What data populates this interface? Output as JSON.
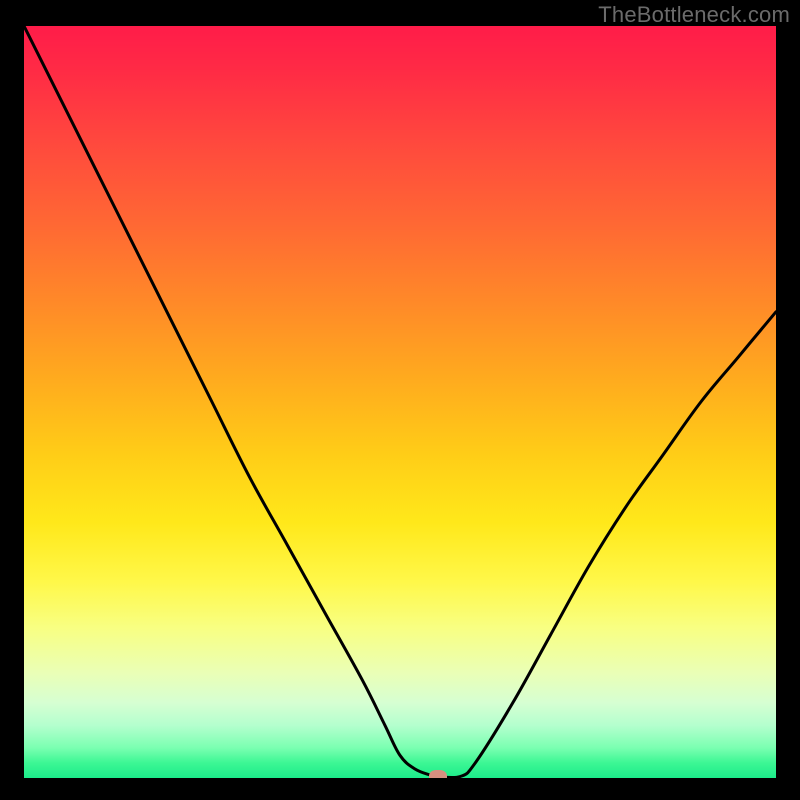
{
  "attribution": "TheBottleneck.com",
  "colors": {
    "frame": "#000000",
    "curve": "#000000",
    "marker": "#d68f80",
    "attribution_text": "#6b6b6b",
    "gradient_top": "#ff1c49",
    "gradient_bottom": "#1ceb8a"
  },
  "chart_data": {
    "type": "line",
    "title": "",
    "xlabel": "",
    "ylabel": "",
    "xlim": [
      0,
      100
    ],
    "ylim": [
      0,
      100
    ],
    "grid": false,
    "legend": false,
    "series": [
      {
        "name": "bottleneck-curve",
        "x": [
          0,
          5,
          10,
          15,
          20,
          25,
          30,
          35,
          40,
          45,
          48,
          50,
          52,
          54,
          55,
          58,
          60,
          65,
          70,
          75,
          80,
          85,
          90,
          95,
          100
        ],
        "values": [
          100,
          90,
          80,
          70,
          60,
          50,
          40,
          31,
          22,
          13,
          7,
          3,
          1.2,
          0.4,
          0.2,
          0.2,
          2,
          10,
          19,
          28,
          36,
          43,
          50,
          56,
          62
        ]
      }
    ],
    "marker": {
      "x": 55,
      "y": 0.1
    },
    "annotations": []
  }
}
